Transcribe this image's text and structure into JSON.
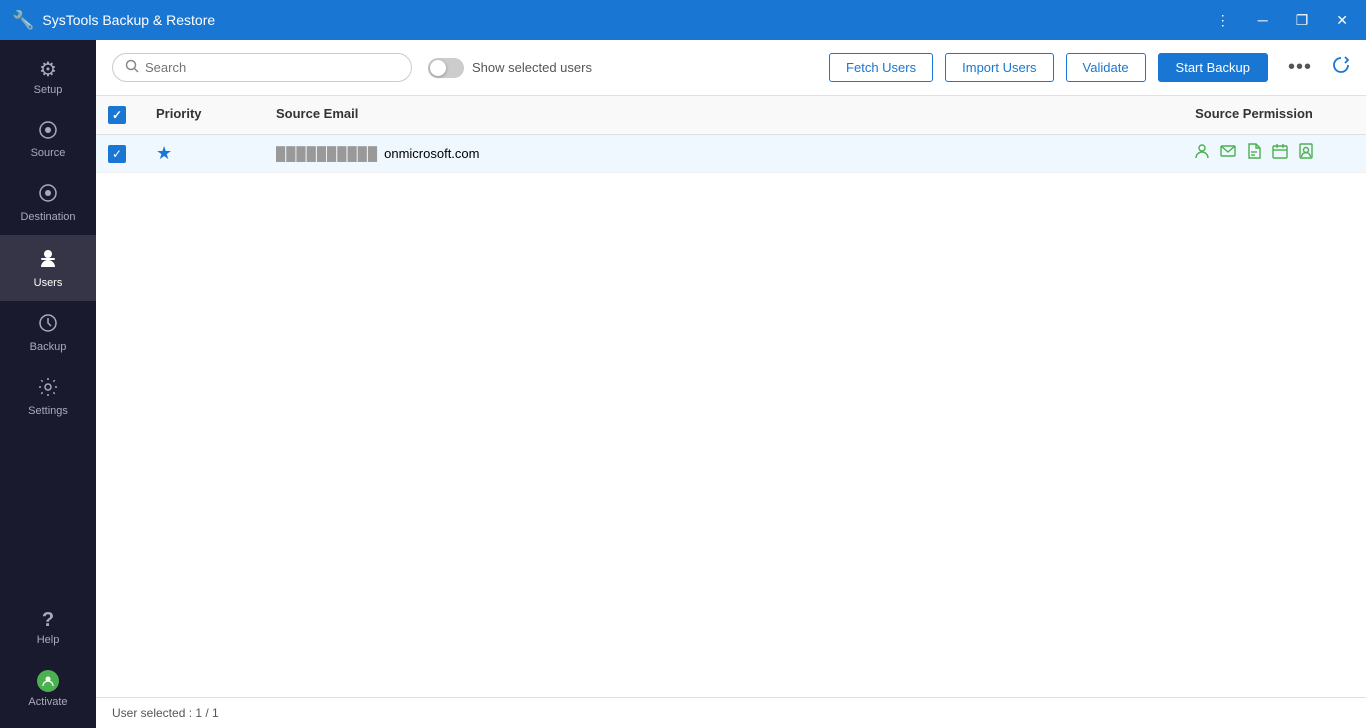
{
  "app": {
    "title": "SysTools Backup & Restore"
  },
  "titlebar": {
    "more_icon": "⋮",
    "minimize_icon": "─",
    "maximize_icon": "❐",
    "close_icon": "✕"
  },
  "sidebar": {
    "items": [
      {
        "id": "setup",
        "label": "Setup",
        "icon": "⚙"
      },
      {
        "id": "source",
        "label": "Source",
        "icon": "◎"
      },
      {
        "id": "destination",
        "label": "Destination",
        "icon": "◎"
      },
      {
        "id": "users",
        "label": "Users",
        "icon": "👤",
        "active": true
      },
      {
        "id": "backup",
        "label": "Backup",
        "icon": "🕐"
      },
      {
        "id": "settings",
        "label": "Settings",
        "icon": "⚙"
      }
    ],
    "bottom": {
      "help_label": "Help",
      "help_icon": "?",
      "activate_label": "Activate",
      "activate_icon": "👤"
    }
  },
  "toolbar": {
    "search_placeholder": "Search",
    "toggle_label": "Show selected users",
    "fetch_label": "Fetch Users",
    "import_label": "Import Users",
    "validate_label": "Validate",
    "start_backup_label": "Start Backup"
  },
  "table": {
    "headers": {
      "priority": "Priority",
      "source_email": "Source Email",
      "source_permission": "Source Permission"
    },
    "rows": [
      {
        "checked": true,
        "starred": true,
        "email_blur": "██████████",
        "email_domain": "onmicrosoft.com",
        "permissions": [
          "person",
          "mail",
          "doc",
          "calendar",
          "contacts"
        ]
      }
    ]
  },
  "statusbar": {
    "text": "User selected : 1 / 1"
  }
}
